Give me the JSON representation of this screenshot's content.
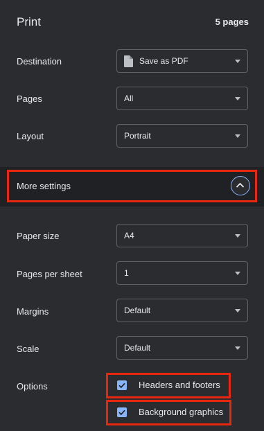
{
  "header": {
    "title": "Print",
    "page_count": "5 pages"
  },
  "destination": {
    "label": "Destination",
    "value": "Save as PDF",
    "icon": "file-icon"
  },
  "pages": {
    "label": "Pages",
    "value": "All"
  },
  "layout": {
    "label": "Layout",
    "value": "Portrait"
  },
  "more_settings": {
    "label": "More settings",
    "expanded": true,
    "icon": "chevron-up-icon"
  },
  "paper_size": {
    "label": "Paper size",
    "value": "A4"
  },
  "pages_per_sheet": {
    "label": "Pages per sheet",
    "value": "1"
  },
  "margins": {
    "label": "Margins",
    "value": "Default"
  },
  "scale": {
    "label": "Scale",
    "value": "Default"
  },
  "options": {
    "label": "Options",
    "items": [
      {
        "label": "Headers and footers",
        "checked": true
      },
      {
        "label": "Background graphics",
        "checked": true
      }
    ]
  },
  "colors": {
    "accent": "#8ab4f8",
    "highlight": "#e8270e",
    "background": "#2b2c2f"
  }
}
